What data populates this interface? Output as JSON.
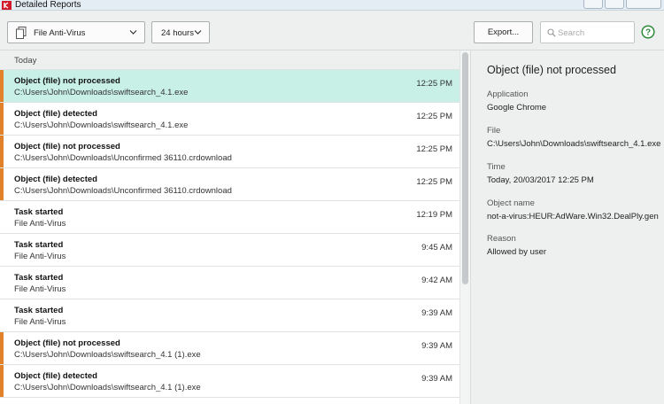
{
  "window": {
    "title": "Detailed Reports"
  },
  "toolbar": {
    "component_select": "File Anti-Virus",
    "period_select": "24 hours",
    "export_label": "Export...",
    "search_placeholder": "Search"
  },
  "list": {
    "section": "Today",
    "rows": [
      {
        "title": "Object (file) not processed",
        "sub": "C:\\Users\\John\\Downloads\\swiftsearch_4.1.exe",
        "time": "12:25 PM",
        "warn": true,
        "selected": true
      },
      {
        "title": "Object (file) detected",
        "sub": "C:\\Users\\John\\Downloads\\swiftsearch_4.1.exe",
        "time": "12:25 PM",
        "warn": true,
        "selected": false
      },
      {
        "title": "Object (file) not processed",
        "sub": "C:\\Users\\John\\Downloads\\Unconfirmed 36110.crdownload",
        "time": "12:25 PM",
        "warn": true,
        "selected": false
      },
      {
        "title": "Object (file) detected",
        "sub": "C:\\Users\\John\\Downloads\\Unconfirmed 36110.crdownload",
        "time": "12:25 PM",
        "warn": true,
        "selected": false
      },
      {
        "title": "Task started",
        "sub": "File Anti-Virus",
        "time": "12:19 PM",
        "warn": false,
        "selected": false
      },
      {
        "title": "Task started",
        "sub": "File Anti-Virus",
        "time": "9:45 AM",
        "warn": false,
        "selected": false
      },
      {
        "title": "Task started",
        "sub": "File Anti-Virus",
        "time": "9:42 AM",
        "warn": false,
        "selected": false
      },
      {
        "title": "Task started",
        "sub": "File Anti-Virus",
        "time": "9:39 AM",
        "warn": false,
        "selected": false
      },
      {
        "title": "Object (file) not processed",
        "sub": "C:\\Users\\John\\Downloads\\swiftsearch_4.1 (1).exe",
        "time": "9:39 AM",
        "warn": true,
        "selected": false
      },
      {
        "title": "Object (file) detected",
        "sub": "C:\\Users\\John\\Downloads\\swiftsearch_4.1 (1).exe",
        "time": "9:39 AM",
        "warn": true,
        "selected": false
      }
    ]
  },
  "details": {
    "title": "Object (file) not processed",
    "application_label": "Application",
    "application_value": "Google Chrome",
    "file_label": "File",
    "file_value": "C:\\Users\\John\\Downloads\\swiftsearch_4.1.exe",
    "time_label": "Time",
    "time_value": "Today, 20/03/2017 12:25 PM",
    "object_label": "Object name",
    "object_value": "not-a-virus:HEUR:AdWare.Win32.DealPly.gen",
    "reason_label": "Reason",
    "reason_value": "Allowed by user"
  },
  "colors": {
    "warning_marker": "#e1822a",
    "selected_row": "#c8f0e6",
    "help_icon": "#2f8a3e"
  },
  "icons": {
    "app": "kaspersky-k-icon",
    "component": "document-icon",
    "dropdown": "chevron-down-icon",
    "search": "search-icon",
    "help": "help-icon"
  }
}
